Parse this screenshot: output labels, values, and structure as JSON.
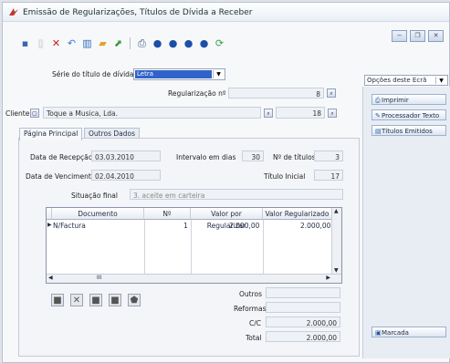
{
  "window": {
    "title": "Emissão de Regularizações, Títulos de Dívida a Receber"
  },
  "toolbar": {
    "icons": [
      "page-dropdown-icon",
      "new-document-icon",
      "delete-icon",
      "undo-icon",
      "chart-icon",
      "folder-icon",
      "export-icon",
      "print-icon",
      "circle-icon",
      "circle-icon",
      "circle-icon",
      "circle-icon",
      "refresh-icon"
    ]
  },
  "form": {
    "serie_label": "Série do título de dívida",
    "serie_value": "Letra",
    "regularizacao_label": "Regularização nº",
    "regularizacao_value": "8",
    "cliente_label": "Cliente",
    "cliente_value": "Toque a Musica, Lda.",
    "cliente_number": "18"
  },
  "tabs": [
    {
      "label": "Página Principal",
      "active": true
    },
    {
      "label": "Outros Dados",
      "active": false
    }
  ],
  "main": {
    "data_recepcao_label": "Data de Recepção",
    "data_recepcao_value": "03.03.2010",
    "intervalo_label": "Intervalo em dias",
    "intervalo_value": "30",
    "n_titulos_label": "Nº de títulos",
    "n_titulos_value": "3",
    "data_vencimento_label": "Data de Vencimento",
    "data_vencimento_value": "02.04.2010",
    "titulo_inicial_label": "Título Inicial",
    "titulo_inicial_value": "17",
    "situacao_label": "Situação final",
    "situacao_value": "3. aceite em carteira"
  },
  "grid": {
    "headers": [
      "Documento",
      "Nº",
      "Valor por Regularizar",
      "Valor Regularizado"
    ],
    "rows": [
      {
        "documento": "N/Factura",
        "numero": "1",
        "valor_por_regularizar": "2.000,00",
        "valor_regularizado": "2.000,00"
      }
    ],
    "scroll_label": "III"
  },
  "totals": {
    "outros_label": "Outros",
    "outros_value": "",
    "reformas_label": "Reformas",
    "reformas_value": "",
    "cc_label": "C/C",
    "cc_value": "2.000,00",
    "total_label": "Total",
    "total_value": "2.000,00"
  },
  "side": {
    "options_select": "Opções deste Ecrã",
    "buttons": [
      "Imprimir",
      "Processador Texto",
      "Títulos Emitidos"
    ],
    "marcada_label": "Marcada"
  }
}
